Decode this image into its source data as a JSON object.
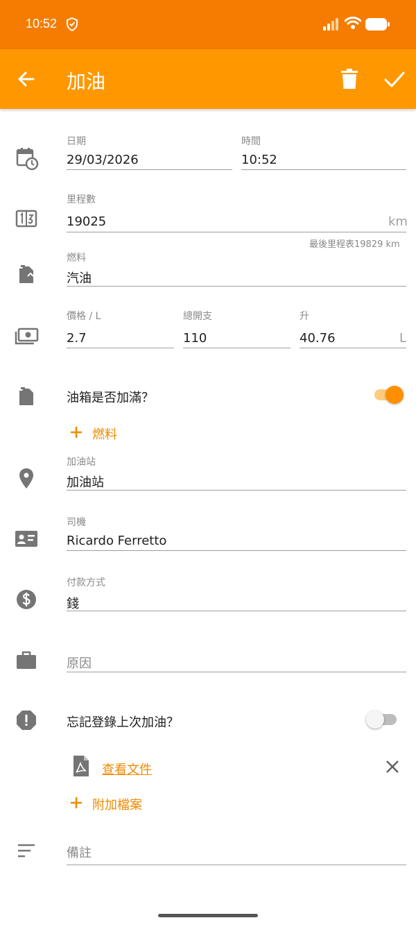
{
  "status_bar": {
    "time": "10:52"
  },
  "app_bar": {
    "title": "加油"
  },
  "date_field": {
    "label": "日期",
    "value": "29/03/2026"
  },
  "time_field": {
    "label": "時間",
    "value": "10:52"
  },
  "mileage_field": {
    "label": "里程數",
    "value": "19025",
    "unit": "km",
    "helper": "最後里程表19829 km"
  },
  "fuel_field": {
    "label": "燃料",
    "value": "汽油"
  },
  "price_field": {
    "label": "價格 / L",
    "value": "2.7"
  },
  "total_field": {
    "label": "總開支",
    "value": "110"
  },
  "liters_field": {
    "label": "升",
    "value": "40.76",
    "unit": "L"
  },
  "full_tank": {
    "label": "油箱是否加滿？",
    "checked": true
  },
  "add_fuel": {
    "label": "燃料"
  },
  "station_field": {
    "label": "加油站",
    "value": "加油站"
  },
  "driver_field": {
    "label": "司機",
    "value": "Ricardo Ferretto"
  },
  "payment_field": {
    "label": "付款方式",
    "value": "錢"
  },
  "reason_field": {
    "placeholder": "原因"
  },
  "forgot_last": {
    "label": "忘記登錄上次加油？",
    "checked": false
  },
  "document": {
    "label": "查看文件"
  },
  "attach": {
    "label": "附加檔案"
  },
  "notes_field": {
    "placeholder": "備註"
  },
  "colors": {
    "status_bar": "#f57c00",
    "app_bar": "#ff9800",
    "accent": "#ff8f00",
    "icon_gray": "#757575"
  }
}
